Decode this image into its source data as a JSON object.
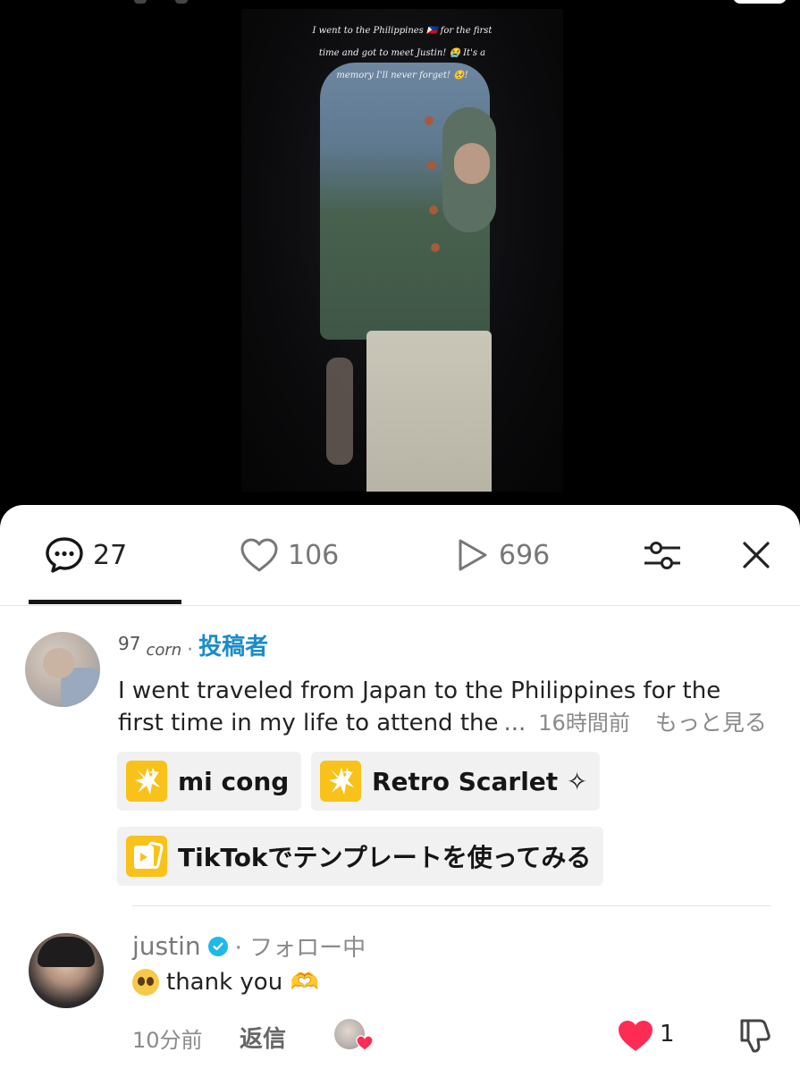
{
  "video": {
    "caption_lines": [
      "I went to the Philippines 🇵🇭 for the first",
      "time and got to meet Justin! 😭 It's a",
      "memory I'll never forget! 🥺!"
    ]
  },
  "tabs": {
    "comments_count": "27",
    "likes_count": "106",
    "views_count": "696"
  },
  "comment1": {
    "author_part1": "97",
    "author_part2": "corn",
    "separator": "·",
    "badge": "投稿者",
    "text_line1": "I went traveled from Japan to the Philippines for the",
    "text_line2": "first time in my life to attend the",
    "ellipsis": "...",
    "time": "16時間前",
    "more": "もっと見る"
  },
  "chips": {
    "chip1": "mi cong",
    "chip2": "Retro Scarlet ✧",
    "chip3": "TikTokでテンプレートを使ってみる"
  },
  "comment2": {
    "author": "justin",
    "follow_status": "· フォロー中",
    "text": "thank you 🫶",
    "time": "10分前",
    "reply": "返信",
    "like_count": "1"
  },
  "colors": {
    "accent_badge": "#1a8cc9",
    "like_heart": "#fe2c55",
    "verified": "#20b8e8",
    "chip_icon": "#f8c21a"
  }
}
